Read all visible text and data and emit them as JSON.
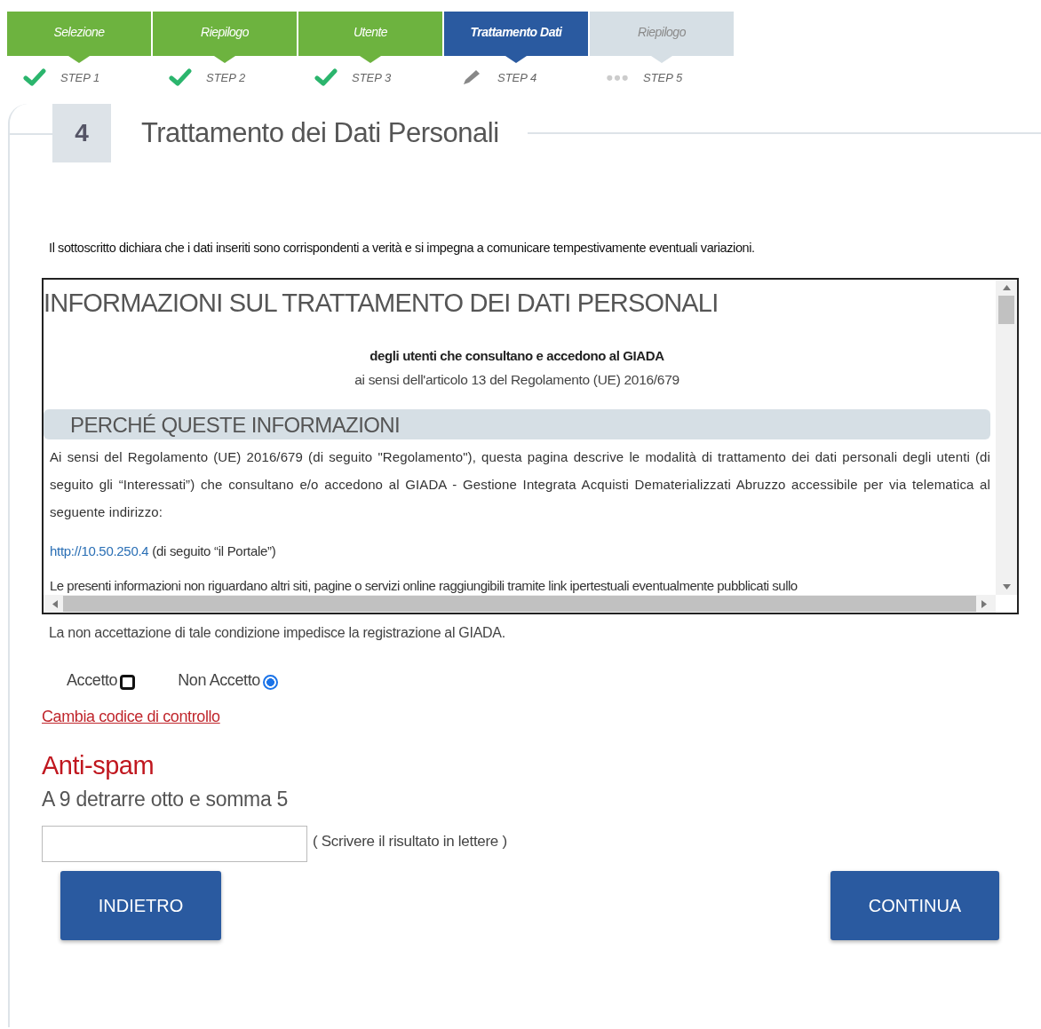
{
  "steps": [
    {
      "label": "Selezione",
      "step": "STEP 1",
      "kind": "done"
    },
    {
      "label": "Riepilogo",
      "step": "STEP 2",
      "kind": "done"
    },
    {
      "label": "Utente",
      "step": "STEP 3",
      "kind": "done"
    },
    {
      "label": "Trattamento Dati",
      "step": "STEP 4",
      "kind": "current"
    },
    {
      "label": "Riepilogo",
      "step": "STEP 5",
      "kind": "pending"
    }
  ],
  "section": {
    "number": "4",
    "title": "Trattamento dei Dati Personali"
  },
  "declaration": "Il sottoscritto dichiara che i dati inseriti sono corrispondenti a verità e si impegna a comunicare tempestivamente eventuali variazioni.",
  "privacy": {
    "title": "INFORMAZIONI SUL TRATTAMENTO DEI DATI PERSONALI",
    "subtitle": "degli utenti che consultano e accedono al GIADA",
    "reference": "ai sensi dell'articolo 13 del Regolamento (UE) 2016/679",
    "heading": "PERCHÉ QUESTE INFORMAZIONI",
    "paragraph": "Ai sensi del Regolamento (UE) 2016/679 (di seguito \"Regolamento\"), questa pagina descrive le modalità di trattamento dei dati personali degli utenti (di seguito gli “Interessati”) che consultano e/o accedono al GIADA - Gestione Integrata Acquisti Dematerializzati Abruzzo accessibile per via telematica al seguente indirizzo:",
    "link": "http://10.50.250.4",
    "link_suffix": "(di seguito “il Portale”)",
    "cut_line": "Le presenti informazioni non riguardano altri siti, pagine o servizi online raggiungibili tramite link ipertestuali eventualmente pubblicati sullo"
  },
  "condition_note": "La non accettazione di tale condizione impedisce la registrazione al GIADA.",
  "consent_options": [
    {
      "label": "Accetto",
      "selected": false
    },
    {
      "label": "Non Accetto",
      "selected": true
    }
  ],
  "change_code_link": "Cambia codice di controllo",
  "antispam": {
    "title": "Anti-spam",
    "question": "A 9 detrarre otto e somma 5",
    "hint": "( Scrivere il risultato in lettere )"
  },
  "buttons": {
    "back": "INDIETRO",
    "next": "CONTINUA"
  }
}
